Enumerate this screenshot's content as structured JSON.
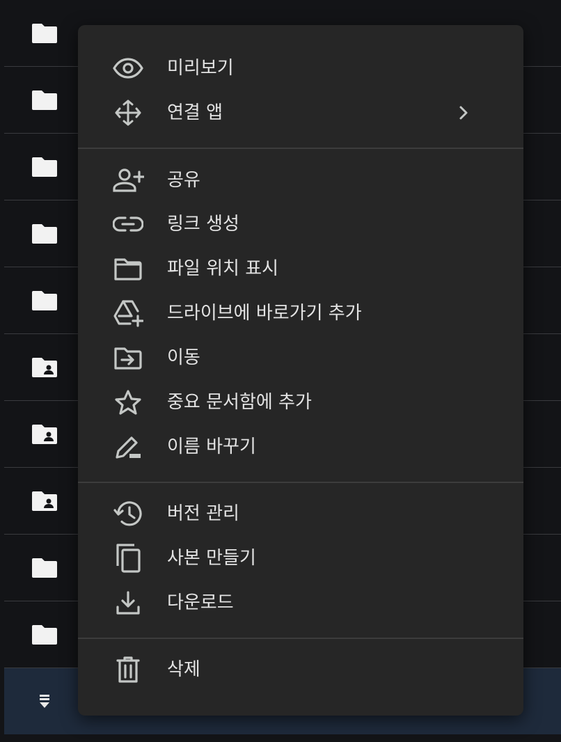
{
  "menu": {
    "groups": [
      {
        "items": [
          {
            "label": "미리보기",
            "icon": "eye-icon"
          },
          {
            "label": "연결 앱",
            "icon": "open-with-icon",
            "submenu_icon": "chevron-right-icon"
          }
        ]
      },
      {
        "items": [
          {
            "label": "공유",
            "icon": "person-add-icon"
          },
          {
            "label": "링크 생성",
            "icon": "link-icon"
          },
          {
            "label": "파일 위치 표시",
            "icon": "folder-icon"
          },
          {
            "label": "드라이브에 바로가기 추가",
            "icon": "add-to-drive-icon"
          },
          {
            "label": "이동",
            "icon": "move-to-folder-icon"
          },
          {
            "label": "중요 문서함에 추가",
            "icon": "star-icon"
          },
          {
            "label": "이름 바꾸기",
            "icon": "rename-icon"
          }
        ]
      },
      {
        "items": [
          {
            "label": "버전 관리",
            "icon": "history-icon"
          },
          {
            "label": "사본 만들기",
            "icon": "copy-icon"
          },
          {
            "label": "다운로드",
            "icon": "download-icon"
          }
        ]
      },
      {
        "items": [
          {
            "label": "삭제",
            "icon": "trash-icon"
          }
        ]
      }
    ]
  },
  "background_list": {
    "rows": [
      {
        "icon": "folder-icon"
      },
      {
        "icon": "folder-icon"
      },
      {
        "icon": "folder-icon"
      },
      {
        "icon": "folder-icon"
      },
      {
        "icon": "folder-icon"
      },
      {
        "icon": "shared-folder-icon"
      },
      {
        "icon": "shared-folder-icon"
      },
      {
        "icon": "shared-folder-icon"
      },
      {
        "icon": "folder-icon"
      },
      {
        "icon": "folder-icon"
      }
    ],
    "selected_row_icon": "drag-handle-icon"
  },
  "colors": {
    "menu_background": "#262626",
    "menu_text": "#e3e3e3",
    "menu_icon": "#c4c7c5",
    "page_background": "#131417",
    "selected_row": "#1e2a3b"
  }
}
